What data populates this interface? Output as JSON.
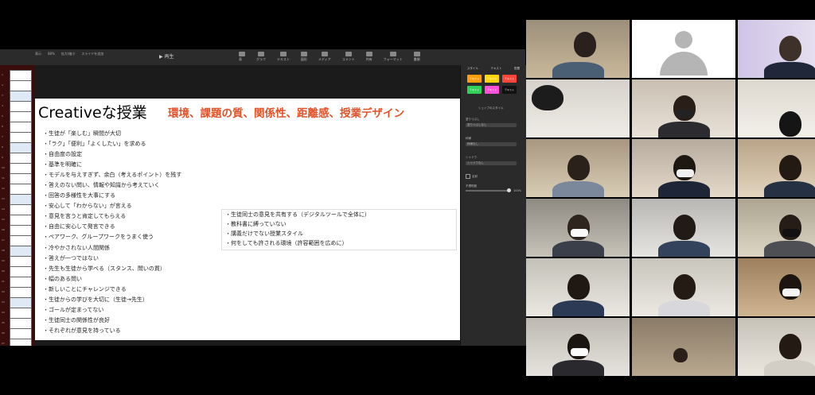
{
  "toolbar": {
    "left_labels": [
      "表示",
      "拡大/縮小",
      "スライドを追加"
    ],
    "zoom_value": "88%",
    "play_label": "再生",
    "mid_items": [
      "表",
      "グラフ",
      "テキスト",
      "図形",
      "メディア",
      "コメント"
    ],
    "right_items": [
      "共有",
      "フォーマット",
      "書類"
    ]
  },
  "thumbnails": {
    "numbers": [
      "1",
      "2",
      "3",
      "4",
      "5",
      "6",
      "7",
      "8",
      "9",
      "10",
      "11",
      "12",
      "13",
      "14",
      "15",
      "16",
      "17",
      "18",
      "19",
      "20",
      "21",
      "22",
      "23",
      "24",
      "25",
      "26",
      "27"
    ]
  },
  "slide": {
    "title": "Creativeな授業",
    "subtitle": "環境、課題の質、関係性、距離感、授業デザイン",
    "items": [
      "・生徒が「楽しむ」瞬間が大切",
      "・「ラク」「便利」「よくしたい」を求める",
      "・自由度の設定",
      "・基準を明確に",
      "・モデルを与えすぎず、余白（考えるポイント）を残す",
      "・答えのない問い、情報や知識から考えていく",
      "・回答の多様性を大事にする",
      "・安心して「わからない」が言える",
      "・意見を言うと肯定してもらえる",
      "・自由に安心して発言できる",
      "・ペアワーク、グループワークをうまく使う",
      "・冷やかされない人間関係",
      "・答えが一つではない",
      "・先生も生徒から学べる（スタンス、問いの質）",
      "・幅のある問い",
      "・新しいことにチャレンジできる",
      "・生徒からの学びを大切に（生徒→先生）",
      "・ゴールが定まってない",
      "・生徒同士の関係性が良好",
      "・それぞれが意見を持っている"
    ],
    "box_items": [
      "・生徒同士の意見を共有する（デジタルツールで全体に）",
      "・教科書に縛っていない",
      "・講義だけでない授業スタイル",
      "・何をしても許される環境（許容範囲を広めに）"
    ]
  },
  "sidebar": {
    "tabs": [
      "スタイル",
      "テキスト",
      "配置"
    ],
    "swatch_colors": [
      "#ff9f0a",
      "#ffd60a",
      "#ff453a",
      "#30d158",
      "#ff4fd8",
      "#111111"
    ],
    "swatch_labels": [
      "テキスト",
      "テキスト",
      "テキスト",
      "テキスト",
      "テキスト",
      "テキスト"
    ],
    "shape_style_label": "シェイプのスタイル",
    "fill_label": "塗りつぶし",
    "fill_value": "塗りつぶしなし",
    "border_label": "枠線",
    "border_value": "枠線なし",
    "shadow_label": "シャドウ",
    "shadow_value": "シャドウなし",
    "reflection_label": "反射",
    "opacity_label": "不透明度",
    "opacity_value": "100%"
  },
  "video": {
    "accent_avatar_bg": "#ffffff"
  }
}
